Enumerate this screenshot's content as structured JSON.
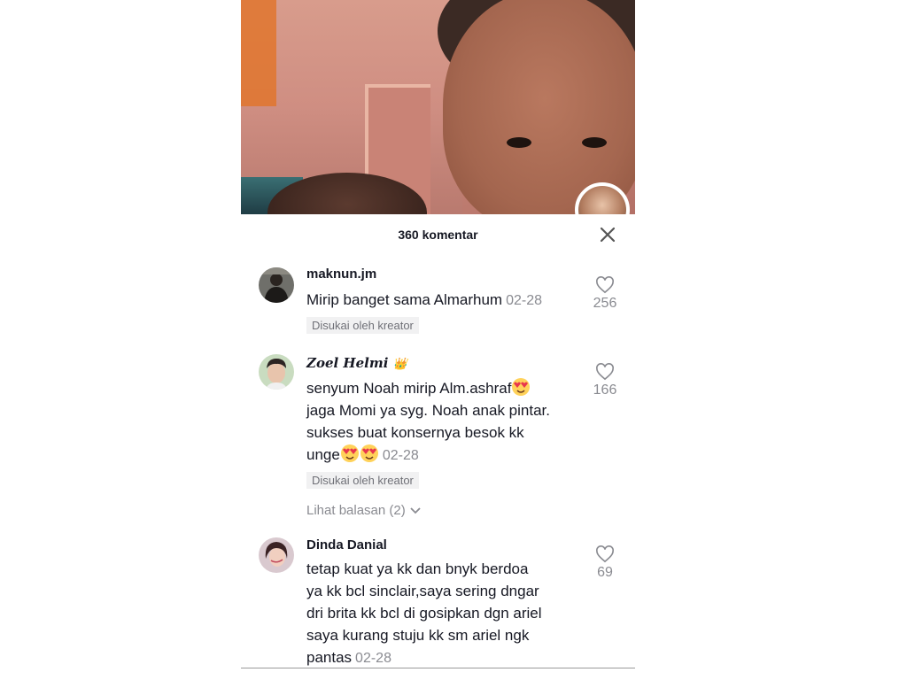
{
  "video": {
    "creator_avatar_icon": "creator-avatar"
  },
  "panel": {
    "title": "360 komentar",
    "close_icon": "close-icon"
  },
  "comments": [
    {
      "username": "maknun.jm",
      "text": "Mirip banget sama Almarhum",
      "date": "02-28",
      "badge": "Disukai oleh kreator",
      "likes": "256"
    },
    {
      "username": "𝒁𝒐𝒆𝒍 𝑯𝒆𝒍𝒎𝒊",
      "username_emoji": "👑",
      "text_line1": "senyum Noah mirip Alm.ashraf",
      "text_line2": "jaga Momi ya syg. Noah anak pintar.",
      "text_line3": "sukses buat konsernya besok kk",
      "text_line4": "unge",
      "date": "02-28",
      "badge": "Disukai oleh kreator",
      "replies": "Lihat balasan (2)",
      "likes": "166"
    },
    {
      "username": "Dinda Danial",
      "text_line1": "tetap kuat ya kk dan bnyk berdoa",
      "text_line2": "ya kk bcl sinclair,saya sering dngar",
      "text_line3": "dri brita kk bcl di gosipkan dgn ariel",
      "text_line4": "saya kurang stuju kk sm ariel ngk",
      "text_line5": "pantas",
      "date": "02-28",
      "likes": "69"
    }
  ]
}
